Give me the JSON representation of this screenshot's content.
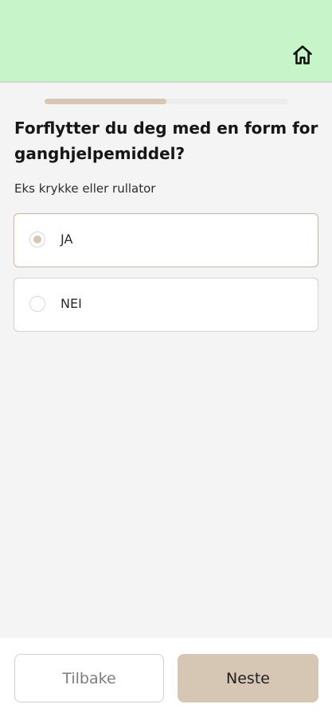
{
  "header": {
    "home_icon": "home-icon",
    "background": "#c8f4c9"
  },
  "progress": {
    "fraction": 0.5,
    "fill_color": "#d6c7b5"
  },
  "question": {
    "title": "Forflytter du deg med en form for ganghjelpemiddel?",
    "helper": "Eks krykke eller rullator"
  },
  "options": [
    {
      "label": "JA",
      "selected": true
    },
    {
      "label": "NEI",
      "selected": false
    }
  ],
  "footer": {
    "back_label": "Tilbake",
    "next_label": "Neste",
    "accent": "#d6c7b5"
  }
}
